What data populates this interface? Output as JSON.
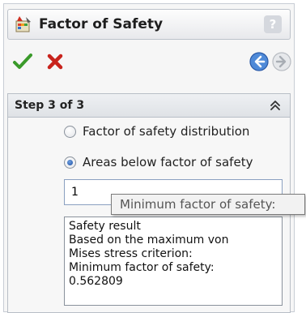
{
  "header": {
    "title": "Factor of Safety",
    "help_label": "?"
  },
  "step": {
    "title": "Step 3 of 3"
  },
  "options": [
    {
      "label": "Factor of safety distribution",
      "checked": false
    },
    {
      "label": "Areas below factor of safety",
      "checked": true
    }
  ],
  "threshold_input": {
    "value": "1"
  },
  "tooltip": {
    "text": "Minimum factor of safety:"
  },
  "result": {
    "lines": [
      "Safety result",
      "Based on the maximum von",
      "Mises stress criterion:",
      "Minimum factor of safety:",
      "0.562809"
    ]
  },
  "colors": {
    "ok_green": "#3a9a2a",
    "cancel_red": "#c8231c",
    "nav_blue": "#2f6fc8",
    "radio_selected": "#1c4ea3"
  }
}
